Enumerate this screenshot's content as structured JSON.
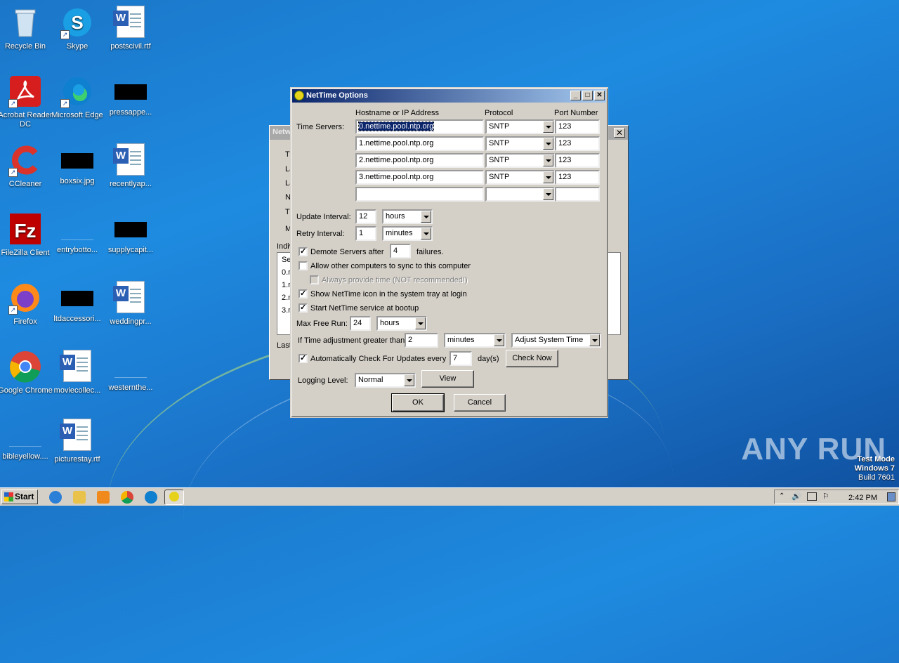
{
  "desktop": {
    "icons": [
      {
        "label": "Recycle Bin"
      },
      {
        "label": "Skype"
      },
      {
        "label": "postscivil.rtf"
      },
      {
        "label": "Acrobat Reader DC"
      },
      {
        "label": "Microsoft Edge"
      },
      {
        "label": "pressappe..."
      },
      {
        "label": "CCleaner"
      },
      {
        "label": "boxsix.jpg"
      },
      {
        "label": "recentlyap..."
      },
      {
        "label": "FileZilla Client"
      },
      {
        "label": "entrybotto..."
      },
      {
        "label": "supplycapit..."
      },
      {
        "label": "Firefox"
      },
      {
        "label": "ltdaccessori..."
      },
      {
        "label": "weddingpr..."
      },
      {
        "label": "Google Chrome"
      },
      {
        "label": "moviecollec..."
      },
      {
        "label": "westernthe..."
      },
      {
        "label": "bibleyellow...."
      },
      {
        "label": "picturestay.rtf"
      }
    ]
  },
  "bg_window": {
    "title": "Netw",
    "labels": [
      "Ti",
      "La",
      "La",
      "N",
      "Ti",
      "M",
      "Indiv",
      "Se",
      "0.n",
      "1.n",
      "2.n",
      "3.n",
      "Last"
    ]
  },
  "dialog": {
    "title": "NetTime Options",
    "headers": {
      "hostname": "Hostname or IP Address",
      "protocol": "Protocol",
      "port": "Port Number"
    },
    "time_servers_label": "Time Servers:",
    "servers": [
      {
        "host": "0.nettime.pool.ntp.org",
        "protocol": "SNTP",
        "port": "123"
      },
      {
        "host": "1.nettime.pool.ntp.org",
        "protocol": "SNTP",
        "port": "123"
      },
      {
        "host": "2.nettime.pool.ntp.org",
        "protocol": "SNTP",
        "port": "123"
      },
      {
        "host": "3.nettime.pool.ntp.org",
        "protocol": "SNTP",
        "port": "123"
      },
      {
        "host": "",
        "protocol": "",
        "port": ""
      }
    ],
    "update_interval": {
      "label": "Update Interval:",
      "value": "12",
      "unit": "hours"
    },
    "retry_interval": {
      "label": "Retry Interval:",
      "value": "1",
      "unit": "minutes"
    },
    "demote": {
      "label": "Demote Servers after",
      "value": "4",
      "suffix": "failures.",
      "checked": true
    },
    "allow_sync": {
      "label": "Allow other computers to sync to this computer",
      "checked": false
    },
    "always_provide": {
      "label": "Always provide time (NOT recommended!)",
      "checked": false
    },
    "show_icon": {
      "label": "Show NetTime icon in the system tray at login",
      "checked": true
    },
    "start_service": {
      "label": "Start NetTime service at bootup",
      "checked": true
    },
    "max_free_run": {
      "label": "Max Free Run:",
      "value": "24",
      "unit": "hours"
    },
    "time_adjust": {
      "label": "If Time adjustment greater than",
      "value": "2",
      "unit": "minutes",
      "action": "Adjust System Time"
    },
    "auto_check": {
      "label": "Automatically Check For Updates every",
      "value": "7",
      "unit": "day(s)",
      "checked": true,
      "button": "Check Now"
    },
    "logging": {
      "label": "Logging Level:",
      "value": "Normal",
      "view_button": "View"
    },
    "ok": "OK",
    "cancel": "Cancel"
  },
  "taskbar": {
    "start": "Start",
    "clock": "2:42 PM"
  },
  "watermark": "ANY RUN",
  "test_mode": {
    "line1": "Test Mode",
    "line2": "Windows 7",
    "line3": "Build 7601"
  }
}
